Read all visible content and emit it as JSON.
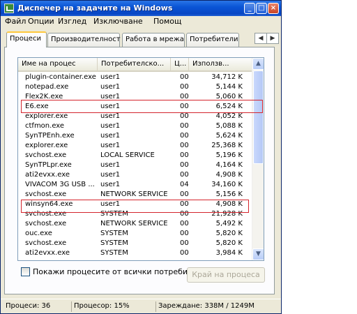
{
  "window": {
    "title": "Диспечер на задачите на Windows"
  },
  "menu": [
    "Файл",
    "Опции",
    "Изглед",
    "Изключване",
    "Помощ"
  ],
  "tabs": [
    "Процеси",
    "Производителност",
    "Работа в мрежа",
    "Потребители"
  ],
  "table": {
    "headers": {
      "name": "Име на процес",
      "user": "Потребителско...",
      "cpu": "Ц...",
      "mem": "Използв..."
    },
    "rows": [
      {
        "name": "plugin-container.exe",
        "user": "user1",
        "cpu": "00",
        "mem": "34,712 K"
      },
      {
        "name": "notepad.exe",
        "user": "user1",
        "cpu": "00",
        "mem": "5,144 K"
      },
      {
        "name": "Flex2K.exe",
        "user": "user1",
        "cpu": "00",
        "mem": "5,060 K"
      },
      {
        "name": "E6.exe",
        "user": "user1",
        "cpu": "00",
        "mem": "6,524 K"
      },
      {
        "name": "explorer.exe",
        "user": "user1",
        "cpu": "00",
        "mem": "4,052 K"
      },
      {
        "name": "ctfmon.exe",
        "user": "user1",
        "cpu": "00",
        "mem": "5,088 K"
      },
      {
        "name": "SynTPEnh.exe",
        "user": "user1",
        "cpu": "00",
        "mem": "5,624 K"
      },
      {
        "name": "explorer.exe",
        "user": "user1",
        "cpu": "00",
        "mem": "25,368 K"
      },
      {
        "name": "svchost.exe",
        "user": "LOCAL SERVICE",
        "cpu": "00",
        "mem": "5,196 K"
      },
      {
        "name": "SynTPLpr.exe",
        "user": "user1",
        "cpu": "00",
        "mem": "4,164 K"
      },
      {
        "name": "ati2evxx.exe",
        "user": "user1",
        "cpu": "00",
        "mem": "4,908 K"
      },
      {
        "name": "VIVACOM 3G USB ...",
        "user": "user1",
        "cpu": "04",
        "mem": "34,160 K"
      },
      {
        "name": "svchost.exe",
        "user": "NETWORK SERVICE",
        "cpu": "00",
        "mem": "5,156 K"
      },
      {
        "name": "winsyn64.exe",
        "user": "user1",
        "cpu": "00",
        "mem": "4,908 K"
      },
      {
        "name": "svchost.exe",
        "user": "SYSTEM",
        "cpu": "00",
        "mem": "21,928 K"
      },
      {
        "name": "svchost.exe",
        "user": "NETWORK SERVICE",
        "cpu": "00",
        "mem": "5,492 K"
      },
      {
        "name": "ouc.exe",
        "user": "SYSTEM",
        "cpu": "00",
        "mem": "5,820 K"
      },
      {
        "name": "svchost.exe",
        "user": "SYSTEM",
        "cpu": "00",
        "mem": "5,820 K"
      },
      {
        "name": "ati2evxx.exe",
        "user": "SYSTEM",
        "cpu": "00",
        "mem": "3,984 K"
      }
    ]
  },
  "show_all_label": "Покажи процесите от всички потребители",
  "end_process_label": "Край на процеса",
  "status": {
    "processes": "Процеси: 36",
    "cpu": "Процесор: 15%",
    "commit": "Зареждане: 338M / 1249M"
  }
}
